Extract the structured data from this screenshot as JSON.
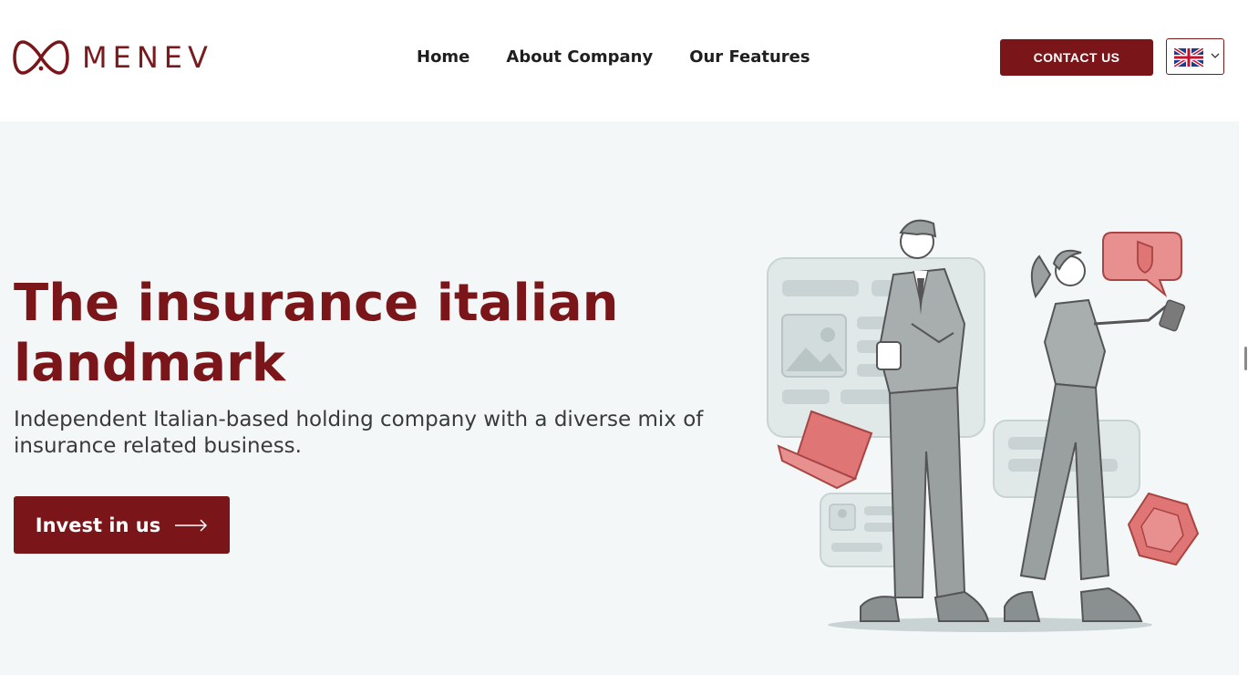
{
  "brand": {
    "name": "MENEV",
    "logo_icon": "infinity-logo-icon",
    "color": "#7a1619"
  },
  "nav": {
    "items": [
      {
        "label": "Home"
      },
      {
        "label": "About Company"
      },
      {
        "label": "Our Features"
      }
    ]
  },
  "header": {
    "contact_label": "CONTACT US",
    "language_icon": "uk-flag-icon"
  },
  "hero": {
    "title": "The insurance italian landmark",
    "subtitle": "Independent Italian-based holding company with a diverse mix of insurance related business.",
    "cta_label": "Invest in us"
  },
  "colors": {
    "accent": "#7a1619",
    "background": "#f3f7f7",
    "illustration_accent": "#e07575"
  }
}
